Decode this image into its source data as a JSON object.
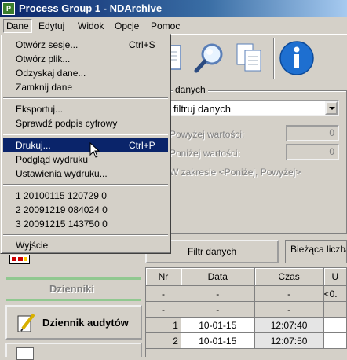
{
  "window": {
    "title": "Process Group 1 - NDArchive",
    "app_icon": "P"
  },
  "menubar": [
    {
      "label": "Dane",
      "active": true
    },
    {
      "label": "Edytuj"
    },
    {
      "label": "Widok"
    },
    {
      "label": "Opcje"
    },
    {
      "label": "Pomoc"
    }
  ],
  "toolbar": {
    "icons": [
      "document-icon",
      "search-icon",
      "copy-icon",
      "info-icon"
    ]
  },
  "dane_menu": {
    "items": [
      {
        "label": "Otwórz sesje...",
        "shortcut": "Ctrl+S"
      },
      {
        "label": "Otwórz plik...",
        "shortcut": ""
      },
      {
        "label": "Odzyskaj dane...",
        "shortcut": ""
      },
      {
        "label": "Zamknij dane",
        "shortcut": ""
      },
      {
        "label": "Eksportuj...",
        "shortcut": ""
      },
      {
        "label": "Sprawdź podpis cyfrowy",
        "shortcut": ""
      },
      {
        "label": "Drukuj...",
        "shortcut": "Ctrl+P",
        "highlighted": true
      },
      {
        "label": "Podgląd wydruku",
        "shortcut": ""
      },
      {
        "label": "Ustawienia wydruku...",
        "shortcut": ""
      },
      {
        "label": "1 20100115 120729 0",
        "shortcut": ""
      },
      {
        "label": "2 20091219 084024 0",
        "shortcut": ""
      },
      {
        "label": "3 20091215 143750 0",
        "shortcut": ""
      },
      {
        "label": "Wyjście",
        "shortcut": ""
      }
    ]
  },
  "filter": {
    "group_title": "danych",
    "select_value": "filtruj danych",
    "above_label": "Powyżej wartości:",
    "above_value": "0",
    "below_label": "Poniżej wartości:",
    "below_value": "0",
    "range_label": "W zakresie <Poniżej, Powyżej>"
  },
  "filter_button": "Filtr danych",
  "counter_label": "Bieżąca liczba r",
  "left_panel": {
    "section_label": "Dzienniki",
    "audit_button": "Dziennik audytów"
  },
  "table": {
    "columns": [
      "Nr",
      "Data",
      "Czas",
      "U"
    ],
    "rows": [
      [
        "-",
        "-",
        "-",
        "<0."
      ],
      [
        "-",
        "-",
        "-",
        ""
      ],
      [
        "1",
        "10-01-15",
        "12:07:40",
        ""
      ],
      [
        "2",
        "10-01-15",
        "12:07:50",
        ""
      ]
    ]
  },
  "colors": {
    "titlebar": "#0a246a",
    "menu_highlight": "#0a246a",
    "panel": "#d4d0c8",
    "accent_green": "#90c890"
  }
}
